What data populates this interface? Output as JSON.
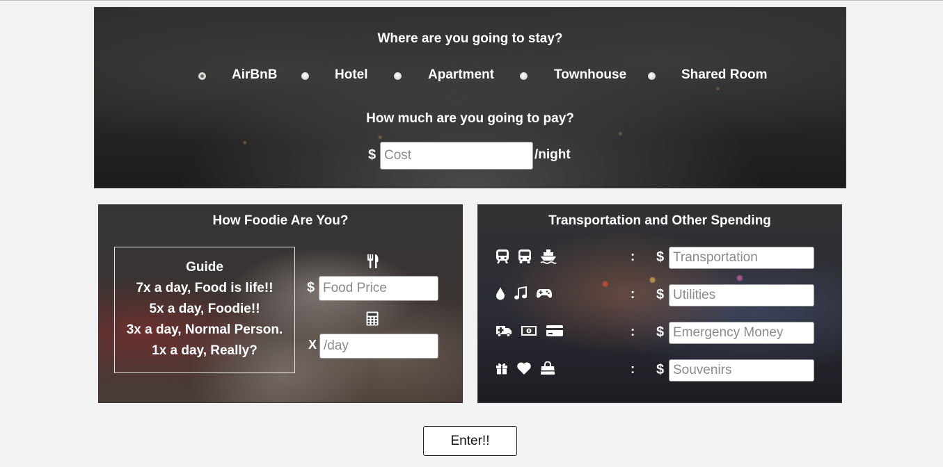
{
  "stay": {
    "title": "Where are you going to stay?",
    "options": [
      {
        "label": "AirBnB",
        "checked": true
      },
      {
        "label": "Hotel",
        "checked": false
      },
      {
        "label": "Apartment",
        "checked": false
      },
      {
        "label": "Townhouse",
        "checked": false
      },
      {
        "label": "Shared Room",
        "checked": false
      }
    ],
    "pay_title": "How much are you going to pay?",
    "currency": "$",
    "cost_placeholder": "Cost",
    "unit": "/night"
  },
  "foodie": {
    "title": "How Foodie Are You?",
    "guide_title": "Guide",
    "guide_lines": [
      "7x a day, Food is life!!",
      "5x a day, Foodie!!",
      "3x a day, Normal Person.",
      "1x a day, Really?"
    ],
    "currency": "$",
    "food_price_placeholder": "Food Price",
    "times": "X",
    "perday_placeholder": "/day"
  },
  "transport": {
    "title": "Transportation and Other Spending",
    "colon": ":",
    "currency": "$",
    "rows": [
      {
        "placeholder": "Transportation",
        "icons": [
          "train-icon",
          "bus-icon",
          "ship-icon"
        ]
      },
      {
        "placeholder": "Utilities",
        "icons": [
          "water-drop-icon",
          "music-icon",
          "gamepad-icon"
        ]
      },
      {
        "placeholder": "Emergency Money",
        "icons": [
          "ambulance-icon",
          "money-icon",
          "credit-card-icon"
        ]
      },
      {
        "placeholder": "Souvenirs",
        "icons": [
          "gift-icon",
          "heart-icon",
          "shopping-bag-icon"
        ]
      }
    ]
  },
  "enter_label": "Enter!!"
}
